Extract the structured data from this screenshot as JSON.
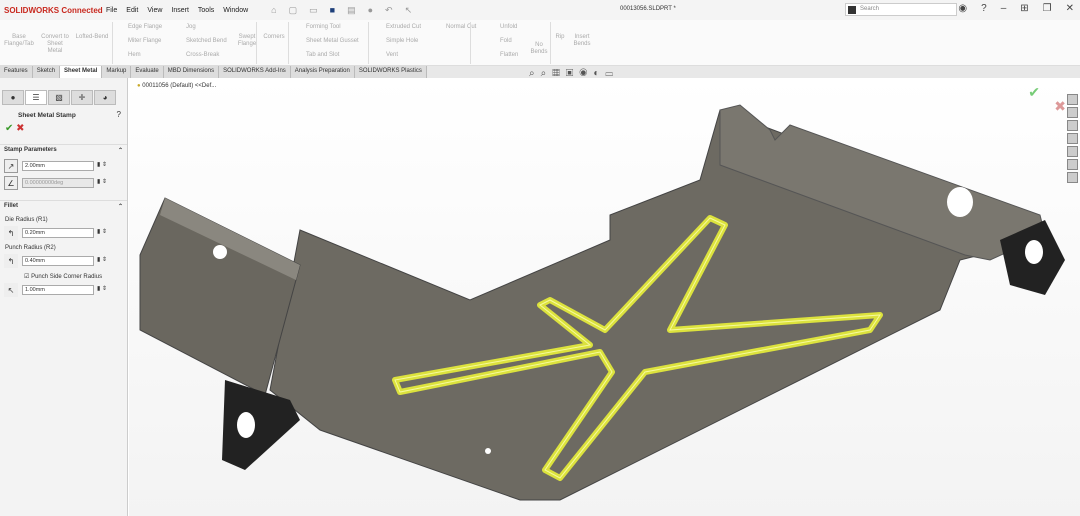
{
  "app": {
    "logo": "SOLIDWORKS Connected",
    "document": "00013056.SLDPRT *",
    "search_placeholder": "Search"
  },
  "menu": [
    "File",
    "Edit",
    "View",
    "Insert",
    "Tools",
    "Window"
  ],
  "ribbon": {
    "big": [
      "Base Flange/Tab",
      "Convert to Sheet Metal",
      "Lofted-Bend",
      "Swept Flange",
      "Corners",
      "No Bends",
      "Rip",
      "Insert Bends"
    ],
    "rows": [
      "Edge Flange",
      "Miter Flange",
      "Hem",
      "Jog",
      "Sketched Bend",
      "Cross-Break",
      "Forming Tool",
      "Sheet Metal Gusset",
      "Tab and Slot",
      "Extruded Cut",
      "Simple Hole",
      "Vent",
      "Normal Cut",
      "Unfold",
      "Fold",
      "Flatten"
    ]
  },
  "tabs": [
    "Features",
    "Sketch",
    "Sheet Metal",
    "Markup",
    "Evaluate",
    "MBD Dimensions",
    "SOLIDWORKS Add-Ins",
    "Analysis Preparation",
    "SOLIDWORKS Plastics"
  ],
  "panel": {
    "title": "Sheet Metal Stamp",
    "section1": "Stamp Parameters",
    "thickness": "2.00mm",
    "angle": "0.00000000deg",
    "section2": "Fillet",
    "die_label": "Die Radius (R1)",
    "die": "0.20mm",
    "punch_label": "Punch Radius (R2)",
    "punch": "0.40mm",
    "corner_label": "Punch Side Corner Radius",
    "corner": "1.00mm"
  },
  "tree": "00011056 (Default) <<Def...",
  "colors": {
    "part": "#6d6a62",
    "stamp": "#e8f03a"
  }
}
